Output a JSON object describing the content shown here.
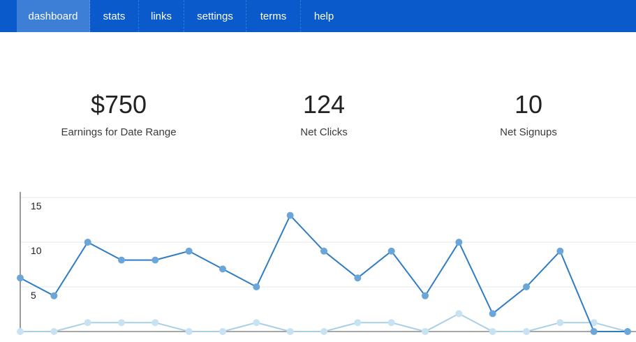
{
  "nav": {
    "items": [
      {
        "label": "dashboard",
        "active": true
      },
      {
        "label": "stats",
        "active": false
      },
      {
        "label": "links",
        "active": false
      },
      {
        "label": "settings",
        "active": false
      },
      {
        "label": "terms",
        "active": false
      },
      {
        "label": "help",
        "active": false
      }
    ]
  },
  "stats": {
    "earnings": {
      "value": "$750",
      "label": "Earnings for Date Range"
    },
    "clicks": {
      "value": "124",
      "label": "Net Clicks"
    },
    "signups": {
      "value": "10",
      "label": "Net Signups"
    }
  },
  "colors": {
    "nav_bg": "#0a5acb",
    "nav_active": "#3d7fd6",
    "series_dark": "#2f7cc4",
    "series_dark_point": "#6aa6d8",
    "series_light": "#a9cfe6",
    "series_light_point": "#c9e2f1"
  },
  "chart_data": {
    "type": "line",
    "ylim": [
      0,
      15
    ],
    "yticks": [
      5,
      10,
      15
    ],
    "grid": true,
    "x": [
      1,
      2,
      3,
      4,
      5,
      6,
      7,
      8,
      9,
      10,
      11,
      12,
      13,
      14,
      15,
      16,
      17,
      18,
      19
    ],
    "series": [
      {
        "values": [
          6,
          4,
          10,
          8,
          8,
          9,
          7,
          5,
          13,
          9,
          6,
          9,
          4,
          10,
          2,
          5,
          9,
          0,
          0
        ]
      },
      {
        "values": [
          0,
          0,
          1,
          1,
          1,
          0,
          0,
          1,
          0,
          0,
          1,
          1,
          0,
          2,
          0,
          0,
          1,
          1,
          0
        ]
      }
    ]
  }
}
